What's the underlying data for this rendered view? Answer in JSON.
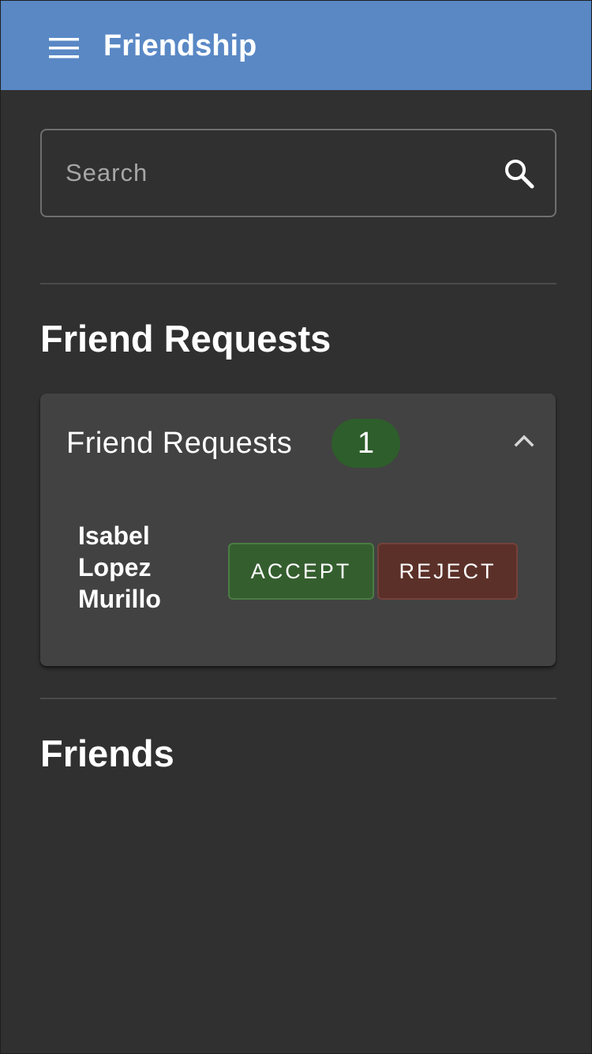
{
  "app_bar": {
    "title": "Friendship",
    "menu_icon": "hamburger-menu-icon",
    "background_color": "#5988c5"
  },
  "search": {
    "placeholder": "Search",
    "value": "",
    "icon": "search-icon"
  },
  "sections": {
    "friend_requests_heading": "Friend Requests",
    "friends_heading": "Friends"
  },
  "requests_panel": {
    "title": "Friend Requests",
    "count": "1",
    "expanded": true,
    "toggle_icon": "chevron-up-icon",
    "badge_color": "#2e5e2b",
    "items": [
      {
        "name": "Isabel Lopez Murillo",
        "accept_label": "ACCEPT",
        "reject_label": "REJECT"
      }
    ]
  },
  "colors": {
    "background": "#303030",
    "panel": "#424242",
    "accept": "#355e2f",
    "reject": "#5b3028"
  }
}
